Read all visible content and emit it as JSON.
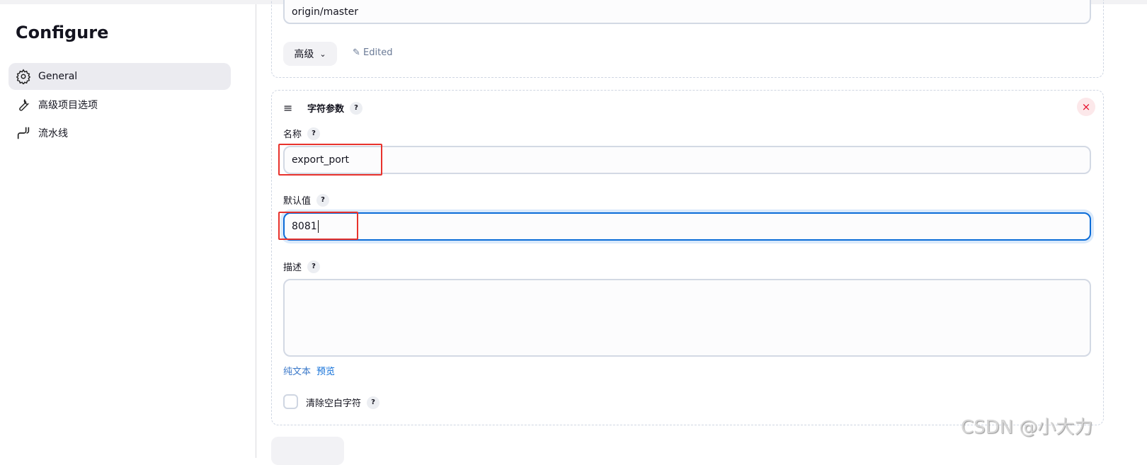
{
  "sidebar": {
    "title": "Configure",
    "items": [
      {
        "label": "General",
        "icon": "gear-icon",
        "active": true
      },
      {
        "label": "高级项目选项",
        "icon": "wrench-icon"
      },
      {
        "label": "流水线",
        "icon": "pipeline-icon"
      }
    ]
  },
  "branch": {
    "value": "origin/master",
    "advanced_label": "高级",
    "edited_label": "Edited"
  },
  "param": {
    "title": "字符参数",
    "name_label": "名称",
    "name_value": "export_port",
    "default_label": "默认值",
    "default_value": "8081",
    "desc_label": "描述",
    "desc_value": "",
    "plain_text": "纯文本",
    "preview": "预览",
    "trim_label": "清除空白字符",
    "help": "?",
    "close": "×"
  },
  "watermark": "CSDN @小大力",
  "colors": {
    "accent": "#0b6cd8",
    "highlight": "#e8322c",
    "close": "#e6102c"
  }
}
